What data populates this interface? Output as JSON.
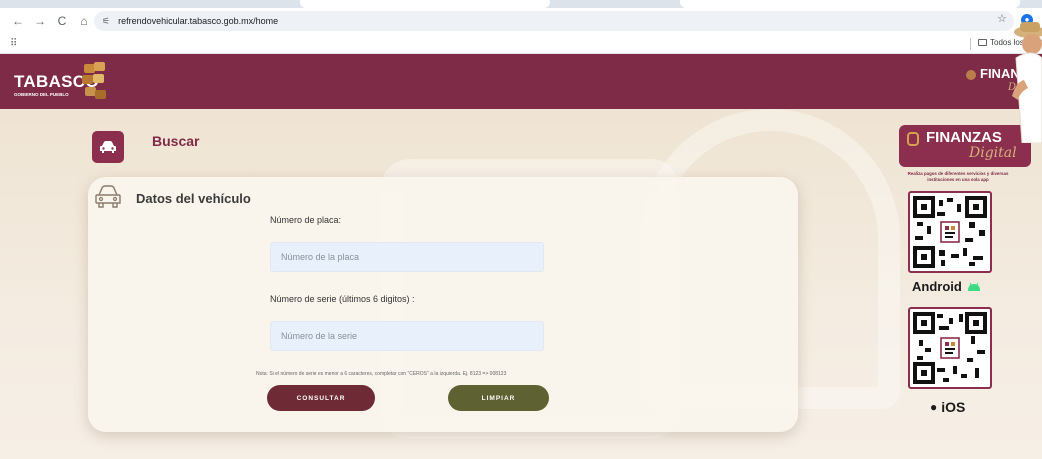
{
  "browser": {
    "url": "refrendovehicular.tabasco.gob.mx/home",
    "bookmarks_label": "Todos los marcad"
  },
  "header": {
    "logo_text": "TABASCO",
    "logo_sub": "GOBIERNO DEL PUEBLO",
    "finanzas": "FINANZAS",
    "digital": "Digital"
  },
  "buscar": {
    "title": "Buscar"
  },
  "form": {
    "section_title": "Datos del vehículo",
    "placa_label": "Número de placa:",
    "placa_placeholder": "Número de la placa",
    "placa_value": "",
    "serie_label": "Número de serie (últimos 6 digitos) :",
    "serie_placeholder": "Número de la serie",
    "serie_value": "",
    "note": "Nota: Si el número de serie es menor a 6 caracteres, completar con \"CEROS\" a la izquierda. Ej. 8123 => 008123",
    "consultar_label": "CONSULTAR",
    "limpiar_label": "LIMPIAR"
  },
  "promo": {
    "finanzas": "FINANZAS",
    "digital": "Digital",
    "subtitle": "Realiza pagos de diferentes servicios y diversas instituciones en una sola app",
    "android_label": "Android",
    "ios_label": "iOS"
  },
  "colors": {
    "brand": "#7e2b48",
    "consultar": "#6e2b35",
    "limpiar": "#5e6131"
  }
}
